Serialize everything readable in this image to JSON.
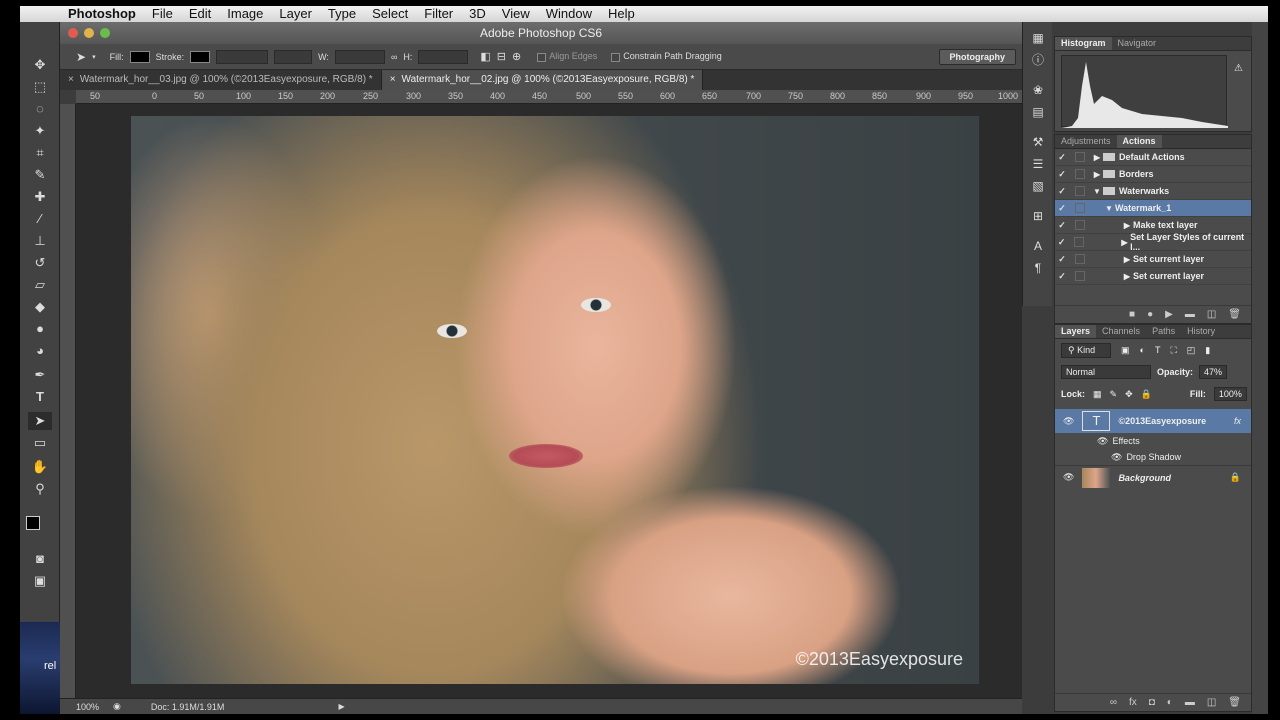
{
  "menu": {
    "app": "Photoshop",
    "items": [
      "File",
      "Edit",
      "Image",
      "Layer",
      "Type",
      "Select",
      "Filter",
      "3D",
      "View",
      "Window",
      "Help"
    ]
  },
  "window": {
    "title": "Adobe Photoshop CS6"
  },
  "options": {
    "fill_label": "Fill:",
    "stroke_label": "Stroke:",
    "w_label": "W:",
    "h_label": "H:",
    "align_edges": "Align Edges",
    "constrain": "Constrain Path Dragging",
    "workspace": "Photography"
  },
  "tabs": [
    {
      "label": "Watermark_hor__03.jpg @ 100% (©2013Easyexposure, RGB/8) *",
      "active": false
    },
    {
      "label": "Watermark_hor__02.jpg @ 100% (©2013Easyexposure, RGB/8) *",
      "active": true
    }
  ],
  "ruler": [
    "50",
    "0",
    "50",
    "100",
    "150",
    "200",
    "250",
    "300",
    "350",
    "400",
    "450",
    "500",
    "550",
    "600",
    "650",
    "700",
    "750",
    "800",
    "850",
    "900",
    "950",
    "1000"
  ],
  "canvas": {
    "watermark": "©2013Easyexposure"
  },
  "status": {
    "zoom": "100%",
    "doc": "Doc: 1.91M/1.91M"
  },
  "histogram": {
    "tabs": [
      "Histogram",
      "Navigator"
    ]
  },
  "actions": {
    "tabs": [
      "Adjustments",
      "Actions"
    ],
    "rows": [
      "Default Actions",
      "Borders",
      "Waterwarks",
      "Watermark_1",
      "Make text layer",
      "Set Layer Styles of current l...",
      "Set current layer",
      "Set current layer"
    ]
  },
  "layers": {
    "tabs": [
      "Layers",
      "Channels",
      "Paths",
      "History"
    ],
    "kind": "Kind",
    "blend": "Normal",
    "opacity_label": "Opacity:",
    "opacity": "47%",
    "lock_label": "Lock:",
    "fill_label": "Fill:",
    "fill": "100%",
    "items": {
      "text_layer": "©2013Easyexposure",
      "effects": "Effects",
      "drop_shadow": "Drop Shadow",
      "background": "Background"
    },
    "fx": "fx",
    "type_glyph": "T"
  },
  "desktop": {
    "fragment": "rel"
  },
  "colors": {
    "selection": "#5a7aa5",
    "panel": "#4b4b4b",
    "menubar": "#e4e4e4"
  }
}
